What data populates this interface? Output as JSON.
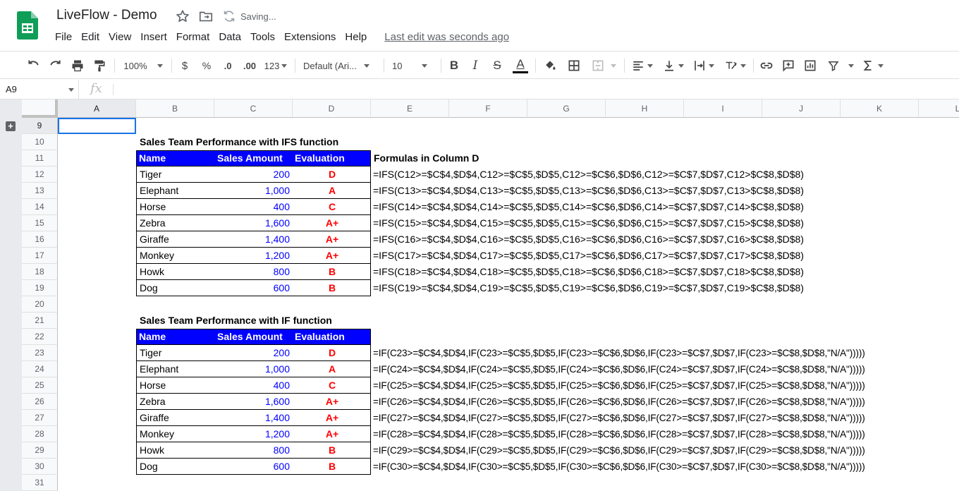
{
  "app": {
    "doc_title": "LiveFlow - Demo",
    "saving_status": "Saving...",
    "last_edit": "Last edit was seconds ago",
    "menu": [
      "File",
      "Edit",
      "View",
      "Insert",
      "Format",
      "Data",
      "Tools",
      "Extensions",
      "Help"
    ]
  },
  "toolbar": {
    "zoom": "100%",
    "currency": "$",
    "percent": "%",
    "dec_decrease": ".0",
    "dec_increase": ".00",
    "more_formats": "123",
    "font": "Default (Ari...",
    "font_size": "10",
    "bold": "B",
    "italic": "I",
    "strike": "S",
    "text_color": "A"
  },
  "formula_bar": {
    "cell_ref": "A9",
    "fx": "fx",
    "content": ""
  },
  "columns": [
    "A",
    "B",
    "C",
    "D",
    "E",
    "F",
    "G",
    "H",
    "I",
    "J",
    "K",
    "L"
  ],
  "rows": [
    "9",
    "10",
    "11",
    "12",
    "13",
    "14",
    "15",
    "16",
    "17",
    "18",
    "19",
    "20",
    "21",
    "22",
    "23",
    "24",
    "25",
    "26",
    "27",
    "28",
    "29",
    "30",
    "31"
  ],
  "ifs_table": {
    "title": "Sales Team Performance with IFS function",
    "header": {
      "name": "Name",
      "amount": "Sales Amount",
      "evaluation": "Evaluation"
    },
    "formulas_label": "Formulas in Column D",
    "rows": [
      {
        "name": "Tiger",
        "amount": "200",
        "eval": "D",
        "formula": "=IFS(C12>=$C$4,$D$4,C12>=$C$5,$D$5,C12>=$C$6,$D$6,C12>=$C$7,$D$7,C12>$C$8,$D$8)"
      },
      {
        "name": "Elephant",
        "amount": "1,000",
        "eval": "A",
        "formula": "=IFS(C13>=$C$4,$D$4,C13>=$C$5,$D$5,C13>=$C$6,$D$6,C13>=$C$7,$D$7,C13>$C$8,$D$8)"
      },
      {
        "name": "Horse",
        "amount": "400",
        "eval": "C",
        "formula": "=IFS(C14>=$C$4,$D$4,C14>=$C$5,$D$5,C14>=$C$6,$D$6,C14>=$C$7,$D$7,C14>$C$8,$D$8)"
      },
      {
        "name": "Zebra",
        "amount": "1,600",
        "eval": "A+",
        "formula": "=IFS(C15>=$C$4,$D$4,C15>=$C$5,$D$5,C15>=$C$6,$D$6,C15>=$C$7,$D$7,C15>$C$8,$D$8)"
      },
      {
        "name": "Giraffe",
        "amount": "1,400",
        "eval": "A+",
        "formula": "=IFS(C16>=$C$4,$D$4,C16>=$C$5,$D$5,C16>=$C$6,$D$6,C16>=$C$7,$D$7,C16>$C$8,$D$8)"
      },
      {
        "name": "Monkey",
        "amount": "1,200",
        "eval": "A+",
        "formula": "=IFS(C17>=$C$4,$D$4,C17>=$C$5,$D$5,C17>=$C$6,$D$6,C17>=$C$7,$D$7,C17>$C$8,$D$8)"
      },
      {
        "name": "Howk",
        "amount": "800",
        "eval": "B",
        "formula": "=IFS(C18>=$C$4,$D$4,C18>=$C$5,$D$5,C18>=$C$6,$D$6,C18>=$C$7,$D$7,C18>$C$8,$D$8)"
      },
      {
        "name": "Dog",
        "amount": "600",
        "eval": "B",
        "formula": "=IFS(C19>=$C$4,$D$4,C19>=$C$5,$D$5,C19>=$C$6,$D$6,C19>=$C$7,$D$7,C19>$C$8,$D$8)"
      }
    ]
  },
  "if_table": {
    "title": "Sales Team Performance with IF function",
    "header": {
      "name": "Name",
      "amount": "Sales Amount",
      "evaluation": "Evaluation"
    },
    "rows": [
      {
        "name": "Tiger",
        "amount": "200",
        "eval": "D",
        "formula": "=IF(C23>=$C$4,$D$4,IF(C23>=$C$5,$D$5,IF(C23>=$C$6,$D$6,IF(C23>=$C$7,$D$7,IF(C23>=$C$8,$D$8,\"N/A\")))))"
      },
      {
        "name": "Elephant",
        "amount": "1,000",
        "eval": "A",
        "formula": "=IF(C24>=$C$4,$D$4,IF(C24>=$C$5,$D$5,IF(C24>=$C$6,$D$6,IF(C24>=$C$7,$D$7,IF(C24>=$C$8,$D$8,\"N/A\")))))"
      },
      {
        "name": "Horse",
        "amount": "400",
        "eval": "C",
        "formula": "=IF(C25>=$C$4,$D$4,IF(C25>=$C$5,$D$5,IF(C25>=$C$6,$D$6,IF(C25>=$C$7,$D$7,IF(C25>=$C$8,$D$8,\"N/A\")))))"
      },
      {
        "name": "Zebra",
        "amount": "1,600",
        "eval": "A+",
        "formula": "=IF(C26>=$C$4,$D$4,IF(C26>=$C$5,$D$5,IF(C26>=$C$6,$D$6,IF(C26>=$C$7,$D$7,IF(C26>=$C$8,$D$8,\"N/A\")))))"
      },
      {
        "name": "Giraffe",
        "amount": "1,400",
        "eval": "A+",
        "formula": "=IF(C27>=$C$4,$D$4,IF(C27>=$C$5,$D$5,IF(C27>=$C$6,$D$6,IF(C27>=$C$7,$D$7,IF(C27>=$C$8,$D$8,\"N/A\")))))"
      },
      {
        "name": "Monkey",
        "amount": "1,200",
        "eval": "A+",
        "formula": "=IF(C28>=$C$4,$D$4,IF(C28>=$C$5,$D$5,IF(C28>=$C$6,$D$6,IF(C28>=$C$7,$D$7,IF(C28>=$C$8,$D$8,\"N/A\")))))"
      },
      {
        "name": "Howk",
        "amount": "800",
        "eval": "B",
        "formula": "=IF(C29>=$C$4,$D$4,IF(C29>=$C$5,$D$5,IF(C29>=$C$6,$D$6,IF(C29>=$C$7,$D$7,IF(C29>=$C$8,$D$8,\"N/A\")))))"
      },
      {
        "name": "Dog",
        "amount": "600",
        "eval": "B",
        "formula": "=IF(C30>=$C$4,$D$4,IF(C30>=$C$5,$D$5,IF(C30>=$C$6,$D$6,IF(C30>=$C$7,$D$7,IF(C30>=$C$8,$D$8,\"N/A\")))))"
      }
    ]
  },
  "colors": {
    "header_fill": "#0000ff",
    "amount_text": "#0000ff",
    "evaluation_text": "#ff0000",
    "sheets_green": "#0f9d58",
    "selection": "#1a73e8"
  }
}
